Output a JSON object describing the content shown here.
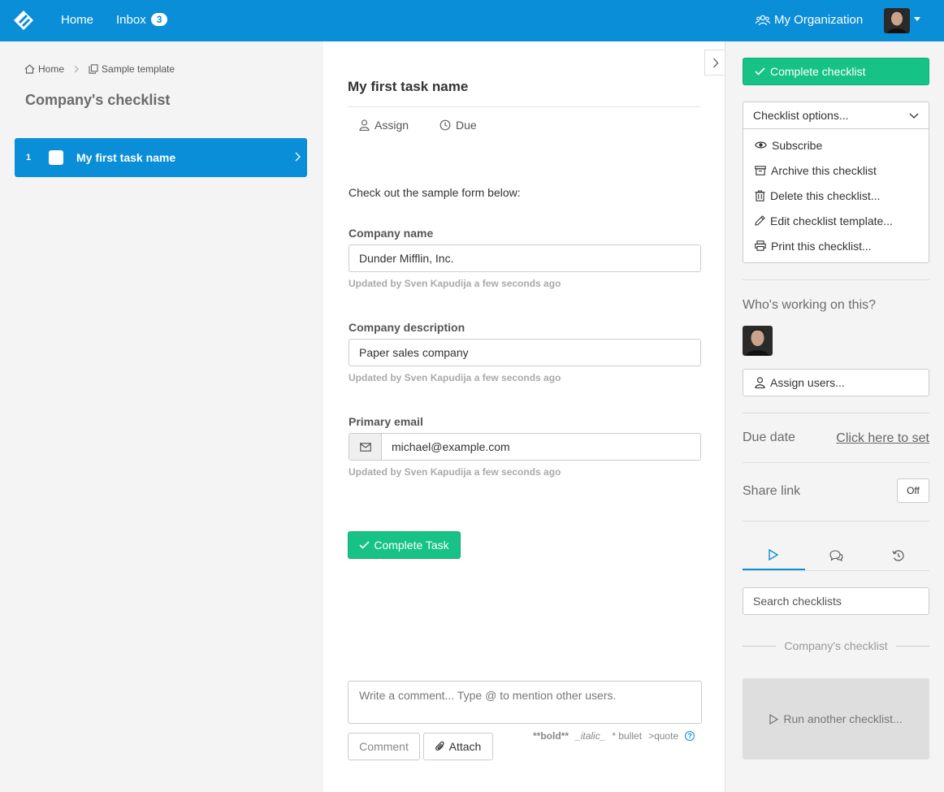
{
  "topbar": {
    "home": "Home",
    "inbox": "Inbox",
    "inbox_count": "3",
    "organization": "My Organization"
  },
  "breadcrumb": {
    "home": "Home",
    "template": "Sample template"
  },
  "checklist": {
    "title": "Company's checklist",
    "tasks": [
      {
        "number": "1",
        "label": "My first task name"
      }
    ]
  },
  "task": {
    "title": "My first task name",
    "assign": "Assign",
    "due": "Due",
    "intro": "Check out the sample form below:",
    "fields": [
      {
        "label": "Company name",
        "value": "Dunder Mifflin, Inc.",
        "updated": "Updated by Sven Kapudija a few seconds ago"
      },
      {
        "label": "Company description",
        "value": "Paper sales company",
        "updated": "Updated by Sven Kapudija a few seconds ago"
      },
      {
        "label": "Primary email",
        "value": "michael@example.com",
        "updated": "Updated by Sven Kapudija a few seconds ago"
      }
    ],
    "complete_button": "Complete Task",
    "comment_placeholder": "Write a comment... Type @ to mention other users.",
    "comment_button": "Comment",
    "attach_button": "Attach",
    "md_bold": "**bold**",
    "md_italic": "_italic_",
    "md_bullet": "* bullet",
    "md_quote": ">quote",
    "md_help": "?"
  },
  "sidebar": {
    "complete_checklist": "Complete checklist",
    "options_label": "Checklist options...",
    "options": [
      {
        "label": "Subscribe",
        "icon": "eye-icon"
      },
      {
        "label": "Archive this checklist",
        "icon": "archive-icon"
      },
      {
        "label": "Delete this checklist...",
        "icon": "trash-icon"
      },
      {
        "label": "Edit checklist template...",
        "icon": "pencil-icon"
      },
      {
        "label": "Print this checklist...",
        "icon": "printer-icon"
      }
    ],
    "who_working": "Who's working on this?",
    "assign_users": "Assign users...",
    "due_date_label": "Due date",
    "due_date_link": "Click here to set",
    "share_link_label": "Share link",
    "share_link_toggle": "Off",
    "search_placeholder": "Search checklists",
    "group_label": "Company's checklist",
    "run_another": "Run another checklist..."
  },
  "colors": {
    "brand": "#0b8ed8",
    "success": "#16c286"
  }
}
